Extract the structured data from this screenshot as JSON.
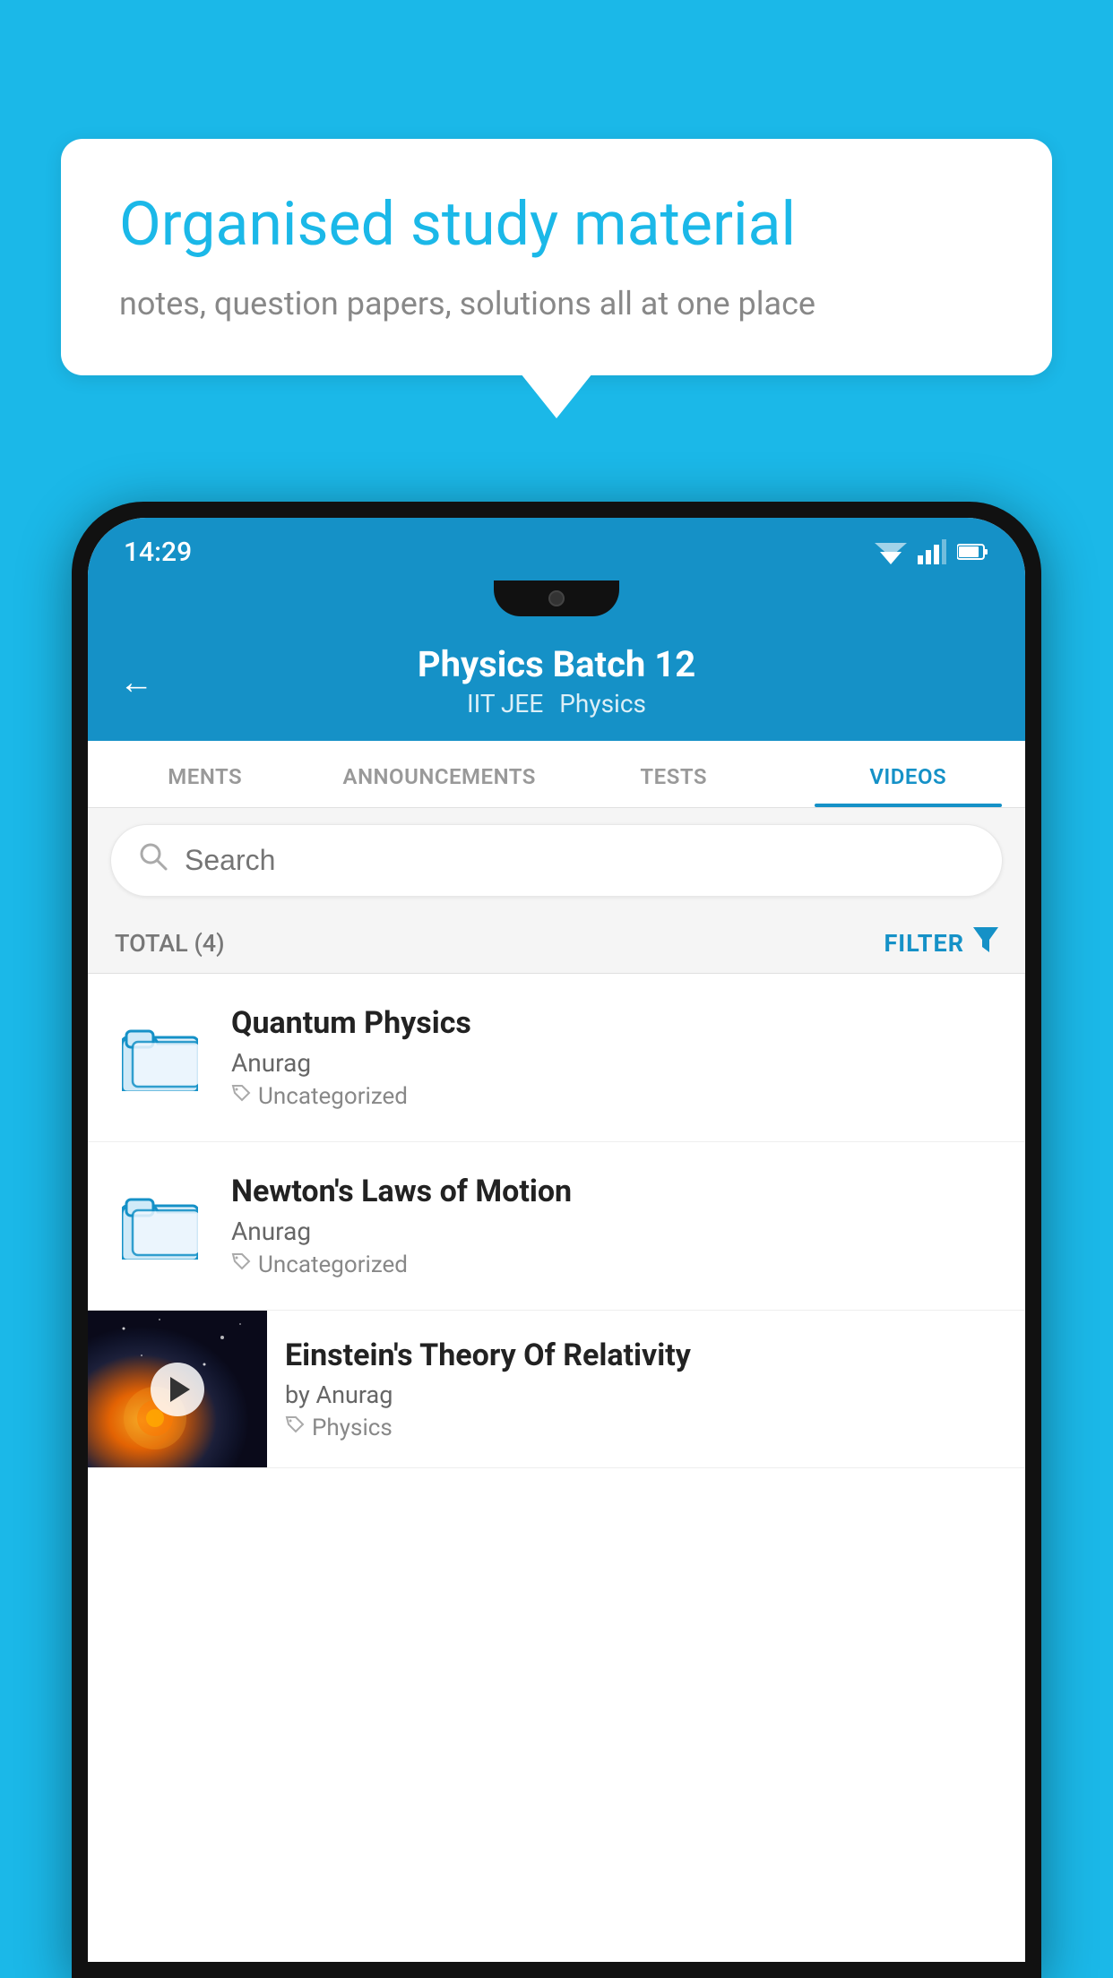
{
  "background": {
    "color": "#1bb8e8"
  },
  "speech_bubble": {
    "title": "Organised study material",
    "subtitle": "notes, question papers, solutions all at one place"
  },
  "phone": {
    "status_bar": {
      "time": "14:29"
    },
    "header": {
      "back_label": "←",
      "title": "Physics Batch 12",
      "subtitle_part1": "IIT JEE",
      "subtitle_part2": "Physics"
    },
    "tabs": [
      {
        "label": "MENTS",
        "active": false
      },
      {
        "label": "ANNOUNCEMENTS",
        "active": false
      },
      {
        "label": "TESTS",
        "active": false
      },
      {
        "label": "VIDEOS",
        "active": true
      }
    ],
    "search": {
      "placeholder": "Search"
    },
    "filter_row": {
      "total_label": "TOTAL (4)",
      "filter_label": "FILTER"
    },
    "videos": [
      {
        "id": 1,
        "title": "Quantum Physics",
        "author": "Anurag",
        "tag": "Uncategorized",
        "has_thumbnail": false
      },
      {
        "id": 2,
        "title": "Newton's Laws of Motion",
        "author": "Anurag",
        "tag": "Uncategorized",
        "has_thumbnail": false
      },
      {
        "id": 3,
        "title": "Einstein's Theory Of Relativity",
        "author": "by Anurag",
        "tag": "Physics",
        "has_thumbnail": true
      }
    ]
  }
}
